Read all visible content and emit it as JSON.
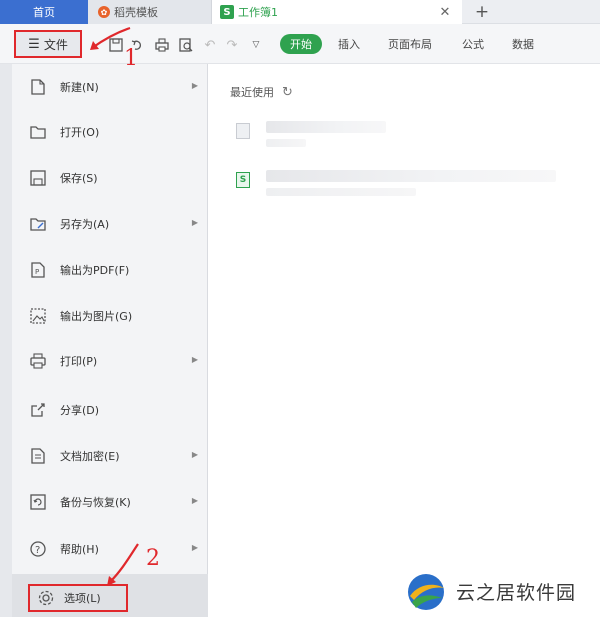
{
  "tabs": {
    "home": "首页",
    "template": "稻壳模板",
    "workbook": "工作簿1",
    "workbook_badge": "S",
    "close_glyph": "✕",
    "add_glyph": "+"
  },
  "toolbar": {
    "file_label": "文件",
    "start_label": "开始",
    "ribbon_tabs": [
      "插入",
      "页面布局",
      "公式",
      "数据"
    ]
  },
  "menu": {
    "items": [
      {
        "label": "新建(N)",
        "icon": "new-file-icon",
        "has_arrow": true
      },
      {
        "label": "打开(O)",
        "icon": "folder-open-icon",
        "has_arrow": false
      },
      {
        "label": "保存(S)",
        "icon": "save-icon",
        "has_arrow": false
      },
      {
        "label": "另存为(A)",
        "icon": "save-as-icon",
        "has_arrow": true
      },
      {
        "label": "输出为PDF(F)",
        "icon": "pdf-export-icon",
        "has_arrow": false
      },
      {
        "label": "输出为图片(G)",
        "icon": "image-export-icon",
        "has_arrow": false
      },
      {
        "label": "打印(P)",
        "icon": "printer-icon",
        "has_arrow": true
      },
      {
        "label": "分享(D)",
        "icon": "share-icon",
        "has_arrow": false
      },
      {
        "label": "文档加密(E)",
        "icon": "encrypt-icon",
        "has_arrow": true
      },
      {
        "label": "备份与恢复(K)",
        "icon": "backup-icon",
        "has_arrow": true
      },
      {
        "label": "帮助(H)",
        "icon": "help-icon",
        "has_arrow": true
      }
    ],
    "options_label": "选项(L)"
  },
  "recent": {
    "title": "最近使用",
    "sheet_badge": "S"
  },
  "annotations": {
    "step1": "1",
    "step2": "2"
  },
  "watermark": {
    "text": "云之居软件园"
  },
  "colors": {
    "accent_green": "#2fa24f",
    "highlight_red": "#e0282c",
    "home_tab_blue": "#3b6fd0"
  }
}
